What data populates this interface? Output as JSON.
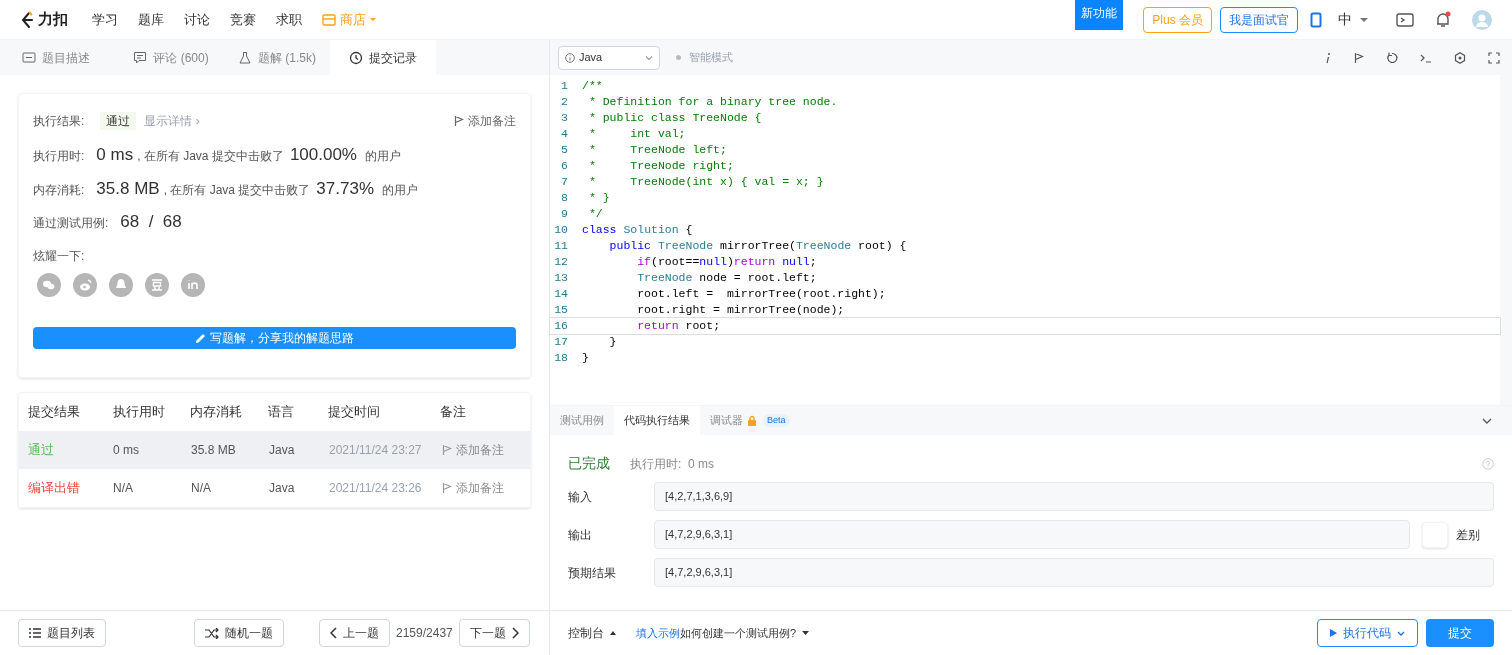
{
  "nav": {
    "logo": "力扣",
    "items": [
      {
        "label": "学习",
        "kind": "plain"
      },
      {
        "label": "题库",
        "kind": "plain"
      },
      {
        "label": "讨论",
        "kind": "plain"
      },
      {
        "label": "竞赛",
        "kind": "plain"
      },
      {
        "label": "求职",
        "kind": "plain"
      },
      {
        "label": "商店",
        "kind": "store"
      }
    ],
    "new_feature": "新功能",
    "plus": "Plus 会员",
    "interviewer": "我是面试官",
    "language": "中"
  },
  "left_tabs": [
    {
      "label": "题目描述",
      "selected": false,
      "kind": "desc"
    },
    {
      "label": "评论 (600)",
      "selected": false,
      "kind": "comment"
    },
    {
      "label": "题解 (1.5k)",
      "selected": false,
      "kind": "solution"
    },
    {
      "label": "提交记录",
      "selected": true,
      "kind": "history"
    }
  ],
  "result": {
    "label": "执行结果:",
    "status": "通过",
    "details": "显示详情 ›",
    "note": "添加备注",
    "time_label": "执行用时:",
    "time": "0 ms",
    "time_text": ", 在所有 Java 提交中击败了",
    "time_pct": "100.00%",
    "time_suffix": "的用户",
    "mem_label": "内存消耗:",
    "mem": "35.8 MB",
    "mem_text": ", 在所有 Java 提交中击败了",
    "mem_pct": "37.73%",
    "mem_suffix": "的用户",
    "cases_label": "通过测试用例:",
    "cases": "68  /  68",
    "share_label": "炫耀一下:",
    "write_button": "写题解，分享我的解题思路"
  },
  "submissions": {
    "columns": [
      "提交结果",
      "执行用时",
      "内存消耗",
      "语言",
      "提交时间",
      "备注"
    ],
    "rows": [
      {
        "status": "通过",
        "kind": "pass",
        "time": "0 ms",
        "memory": "35.8 MB",
        "language": "Java",
        "submitted": "2021/11/24 23:27",
        "note": "添加备注",
        "selected": true
      },
      {
        "status": "编译出错",
        "kind": "error",
        "time": "N/A",
        "memory": "N/A",
        "language": "Java",
        "submitted": "2021/11/24 23:26",
        "note": "添加备注",
        "selected": false
      }
    ]
  },
  "left_footer": {
    "list": "题目列表",
    "random": "随机一题",
    "prev": "上一题",
    "progress": "2159/2437",
    "next": "下一题"
  },
  "editor": {
    "language": "Java",
    "mode": "智能模式",
    "lines": [
      {
        "number": "1",
        "current": false,
        "tokens": [
          {
            "t": "/**",
            "kind": "comment"
          }
        ]
      },
      {
        "number": "2",
        "current": false,
        "tokens": [
          {
            "t": " * Definition for a binary tree node.",
            "kind": "comment"
          }
        ]
      },
      {
        "number": "3",
        "current": false,
        "tokens": [
          {
            "t": " * public class TreeNode {",
            "kind": "comment"
          }
        ]
      },
      {
        "number": "4",
        "current": false,
        "tokens": [
          {
            "t": " *     int val;",
            "kind": "comment"
          }
        ]
      },
      {
        "number": "5",
        "current": false,
        "tokens": [
          {
            "t": " *     TreeNode left;",
            "kind": "comment"
          }
        ]
      },
      {
        "number": "6",
        "current": false,
        "tokens": [
          {
            "t": " *     TreeNode right;",
            "kind": "comment"
          }
        ]
      },
      {
        "number": "7",
        "current": false,
        "tokens": [
          {
            "t": " *     TreeNode(int x) { val = x; }",
            "kind": "comment"
          }
        ]
      },
      {
        "number": "8",
        "current": false,
        "tokens": [
          {
            "t": " * }",
            "kind": "comment"
          }
        ]
      },
      {
        "number": "9",
        "current": false,
        "tokens": [
          {
            "t": " */",
            "kind": "comment"
          }
        ]
      },
      {
        "number": "10",
        "current": false,
        "tokens": [
          {
            "t": "class ",
            "kind": "keyword"
          },
          {
            "t": "Solution",
            "kind": "type"
          },
          {
            "t": " {",
            "kind": "plain"
          }
        ]
      },
      {
        "number": "11",
        "current": false,
        "tokens": [
          {
            "t": "    public ",
            "kind": "keyword"
          },
          {
            "t": "TreeNode",
            "kind": "type"
          },
          {
            "t": " mirrorTree(",
            "kind": "plain"
          },
          {
            "t": "TreeNode",
            "kind": "type"
          },
          {
            "t": " root) {",
            "kind": "plain"
          }
        ]
      },
      {
        "number": "12",
        "current": false,
        "tokens": [
          {
            "t": "        if",
            "kind": "control"
          },
          {
            "t": "(root==",
            "kind": "plain"
          },
          {
            "t": "null",
            "kind": "keyword"
          },
          {
            "t": ")",
            "kind": "plain"
          },
          {
            "t": "return ",
            "kind": "control"
          },
          {
            "t": "null",
            "kind": "keyword"
          },
          {
            "t": ";",
            "kind": "plain"
          }
        ]
      },
      {
        "number": "13",
        "current": false,
        "tokens": [
          {
            "t": "        TreeNode",
            "kind": "type"
          },
          {
            "t": " node = root.left;",
            "kind": "plain"
          }
        ]
      },
      {
        "number": "14",
        "current": false,
        "tokens": [
          {
            "t": "        root.left =  mirrorTree(root.right);",
            "kind": "plain"
          }
        ]
      },
      {
        "number": "15",
        "current": false,
        "tokens": [
          {
            "t": "        root.right = mirrorTree(node);",
            "kind": "plain"
          }
        ]
      },
      {
        "number": "16",
        "current": true,
        "tokens": [
          {
            "t": "        return",
            "kind": "control"
          },
          {
            "t": " root;",
            "kind": "plain"
          }
        ]
      },
      {
        "number": "17",
        "current": false,
        "tokens": [
          {
            "t": "    }",
            "kind": "plain"
          }
        ]
      },
      {
        "number": "18",
        "current": false,
        "tokens": [
          {
            "t": "}",
            "kind": "plain"
          }
        ]
      }
    ]
  },
  "console": {
    "tabs": [
      {
        "label": "测试用例",
        "selected": false,
        "beta": false
      },
      {
        "label": "代码执行结果",
        "selected": true,
        "beta": false
      },
      {
        "label": "调试器",
        "selected": false,
        "beta": true
      }
    ],
    "beta_label": "Beta",
    "status": "已完成",
    "runtime": "执行用时:  0 ms",
    "fields": [
      {
        "label": "输入",
        "value": "[4,2,7,1,3,6,9]",
        "kind": "plain"
      },
      {
        "label": "输出",
        "value": "[4,7,2,9,6,3,1]",
        "kind": "compare"
      },
      {
        "label": "预期结果",
        "value": "[4,7,2,9,6,3,1]",
        "kind": "plain"
      }
    ],
    "diff": {
      "label": "差别",
      "checked": false
    }
  },
  "right_footer": {
    "console": "控制台",
    "fill_example": "填入示例",
    "how_to": "如何创建一个测试用例?",
    "run": "执行代码",
    "submit": "提交"
  }
}
